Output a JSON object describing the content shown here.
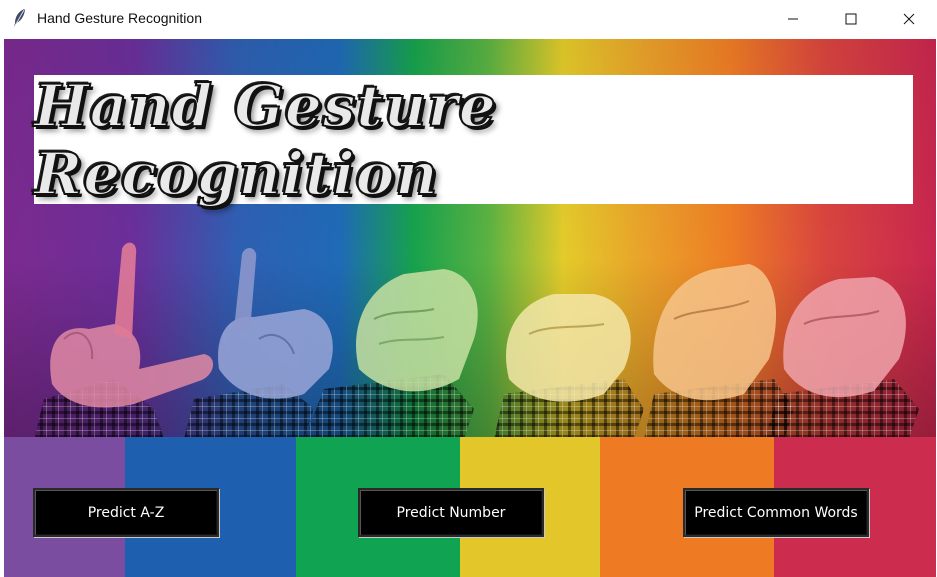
{
  "window": {
    "title": "Hand Gesture Recognition",
    "icon": "feather-icon",
    "controls": [
      "minimize-icon",
      "maximize-icon",
      "close-icon"
    ]
  },
  "banner": {
    "title": "Hand Gesture Recognition"
  },
  "background": {
    "description_colors": [
      "#7c2a8f",
      "#1f5fb0",
      "#0fa350",
      "#e2c62a",
      "#ee7a23",
      "#cc2d4f"
    ]
  },
  "buttons": {
    "predict_az": "Predict A-Z",
    "predict_number": "Predict Number",
    "predict_common_words": "Predict Common Words"
  }
}
